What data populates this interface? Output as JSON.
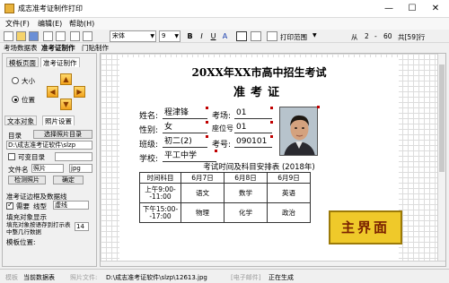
{
  "window": {
    "title": "成志准考证制作打印",
    "minimize": "—",
    "maximize": "☐",
    "close": "✕"
  },
  "menu": [
    "文件(F)",
    "编辑(E)",
    "帮助(H)"
  ],
  "toolbar": {
    "font": "宋体",
    "size": "9",
    "bold": "B",
    "italic": "I",
    "underline": "U",
    "align": "A",
    "print_range": "打印范围",
    "from": "从",
    "from_value": "2",
    "separator": "-",
    "to_value": "60",
    "total": "共[59]行"
  },
  "top_tabs": [
    "考场数据表",
    "准考证制作",
    "门贴制作"
  ],
  "left": {
    "subtabs": [
      "模板页面",
      "准考证制作"
    ],
    "size_label": "大小",
    "position_label": "位置",
    "tabs2": [
      "文本对象",
      "照片设置"
    ],
    "dir_label": "目录",
    "choose_dir": "选择照片目录",
    "dir_path": "D:\\成志准考证软件\\slzp",
    "var_dir": "可变目录",
    "filename_label": "文件名",
    "filename_value": "照片",
    "ext_value": "jpg",
    "check_photo": "检测照片",
    "confirm": "确定",
    "line_header": "准考证边框及数据线",
    "need_label": "需要",
    "line_type_label": "线型",
    "line_type_value": "虚线",
    "fill_header": "填充对象显示",
    "fill_desc": "填充对象按语存到打示表中整几行数据",
    "fill_value": "14",
    "template_pos": "模板位置:"
  },
  "card": {
    "title": "20XX年XX市高中招生考试",
    "subtitle": "准考证",
    "name_label": "姓名:",
    "name_value": "程津锋",
    "room_label": "考场:",
    "room_value": "01",
    "gender_label": "性别:",
    "gender_value": "女",
    "seat_label": "座位号",
    "seat_value": "01",
    "class_label": "班级:",
    "class_value": "初二(2)",
    "exam_no_label": "考号:",
    "exam_no_value": "090101",
    "school_label": "学校:",
    "school_value": "平工中学",
    "schedule_title": "考试时间及科目安排表 (2018年)",
    "schedule": [
      [
        "时间科目",
        "6月7日",
        "6月8日",
        "6月9日"
      ],
      [
        "上午9:00--11:00",
        "语文",
        "数学",
        "英语"
      ],
      [
        "下午15:00--17:00",
        "物理",
        "化学",
        "政治"
      ]
    ]
  },
  "badge": "主界面",
  "status": {
    "db_label": "模板",
    "db_value": "当前数据表",
    "photo_label": "照片文件:",
    "photo_path": "D:\\成志准考证软件\\slzp\\12613.jpg",
    "email_label": "[电子邮件]",
    "state": "正在生成"
  }
}
